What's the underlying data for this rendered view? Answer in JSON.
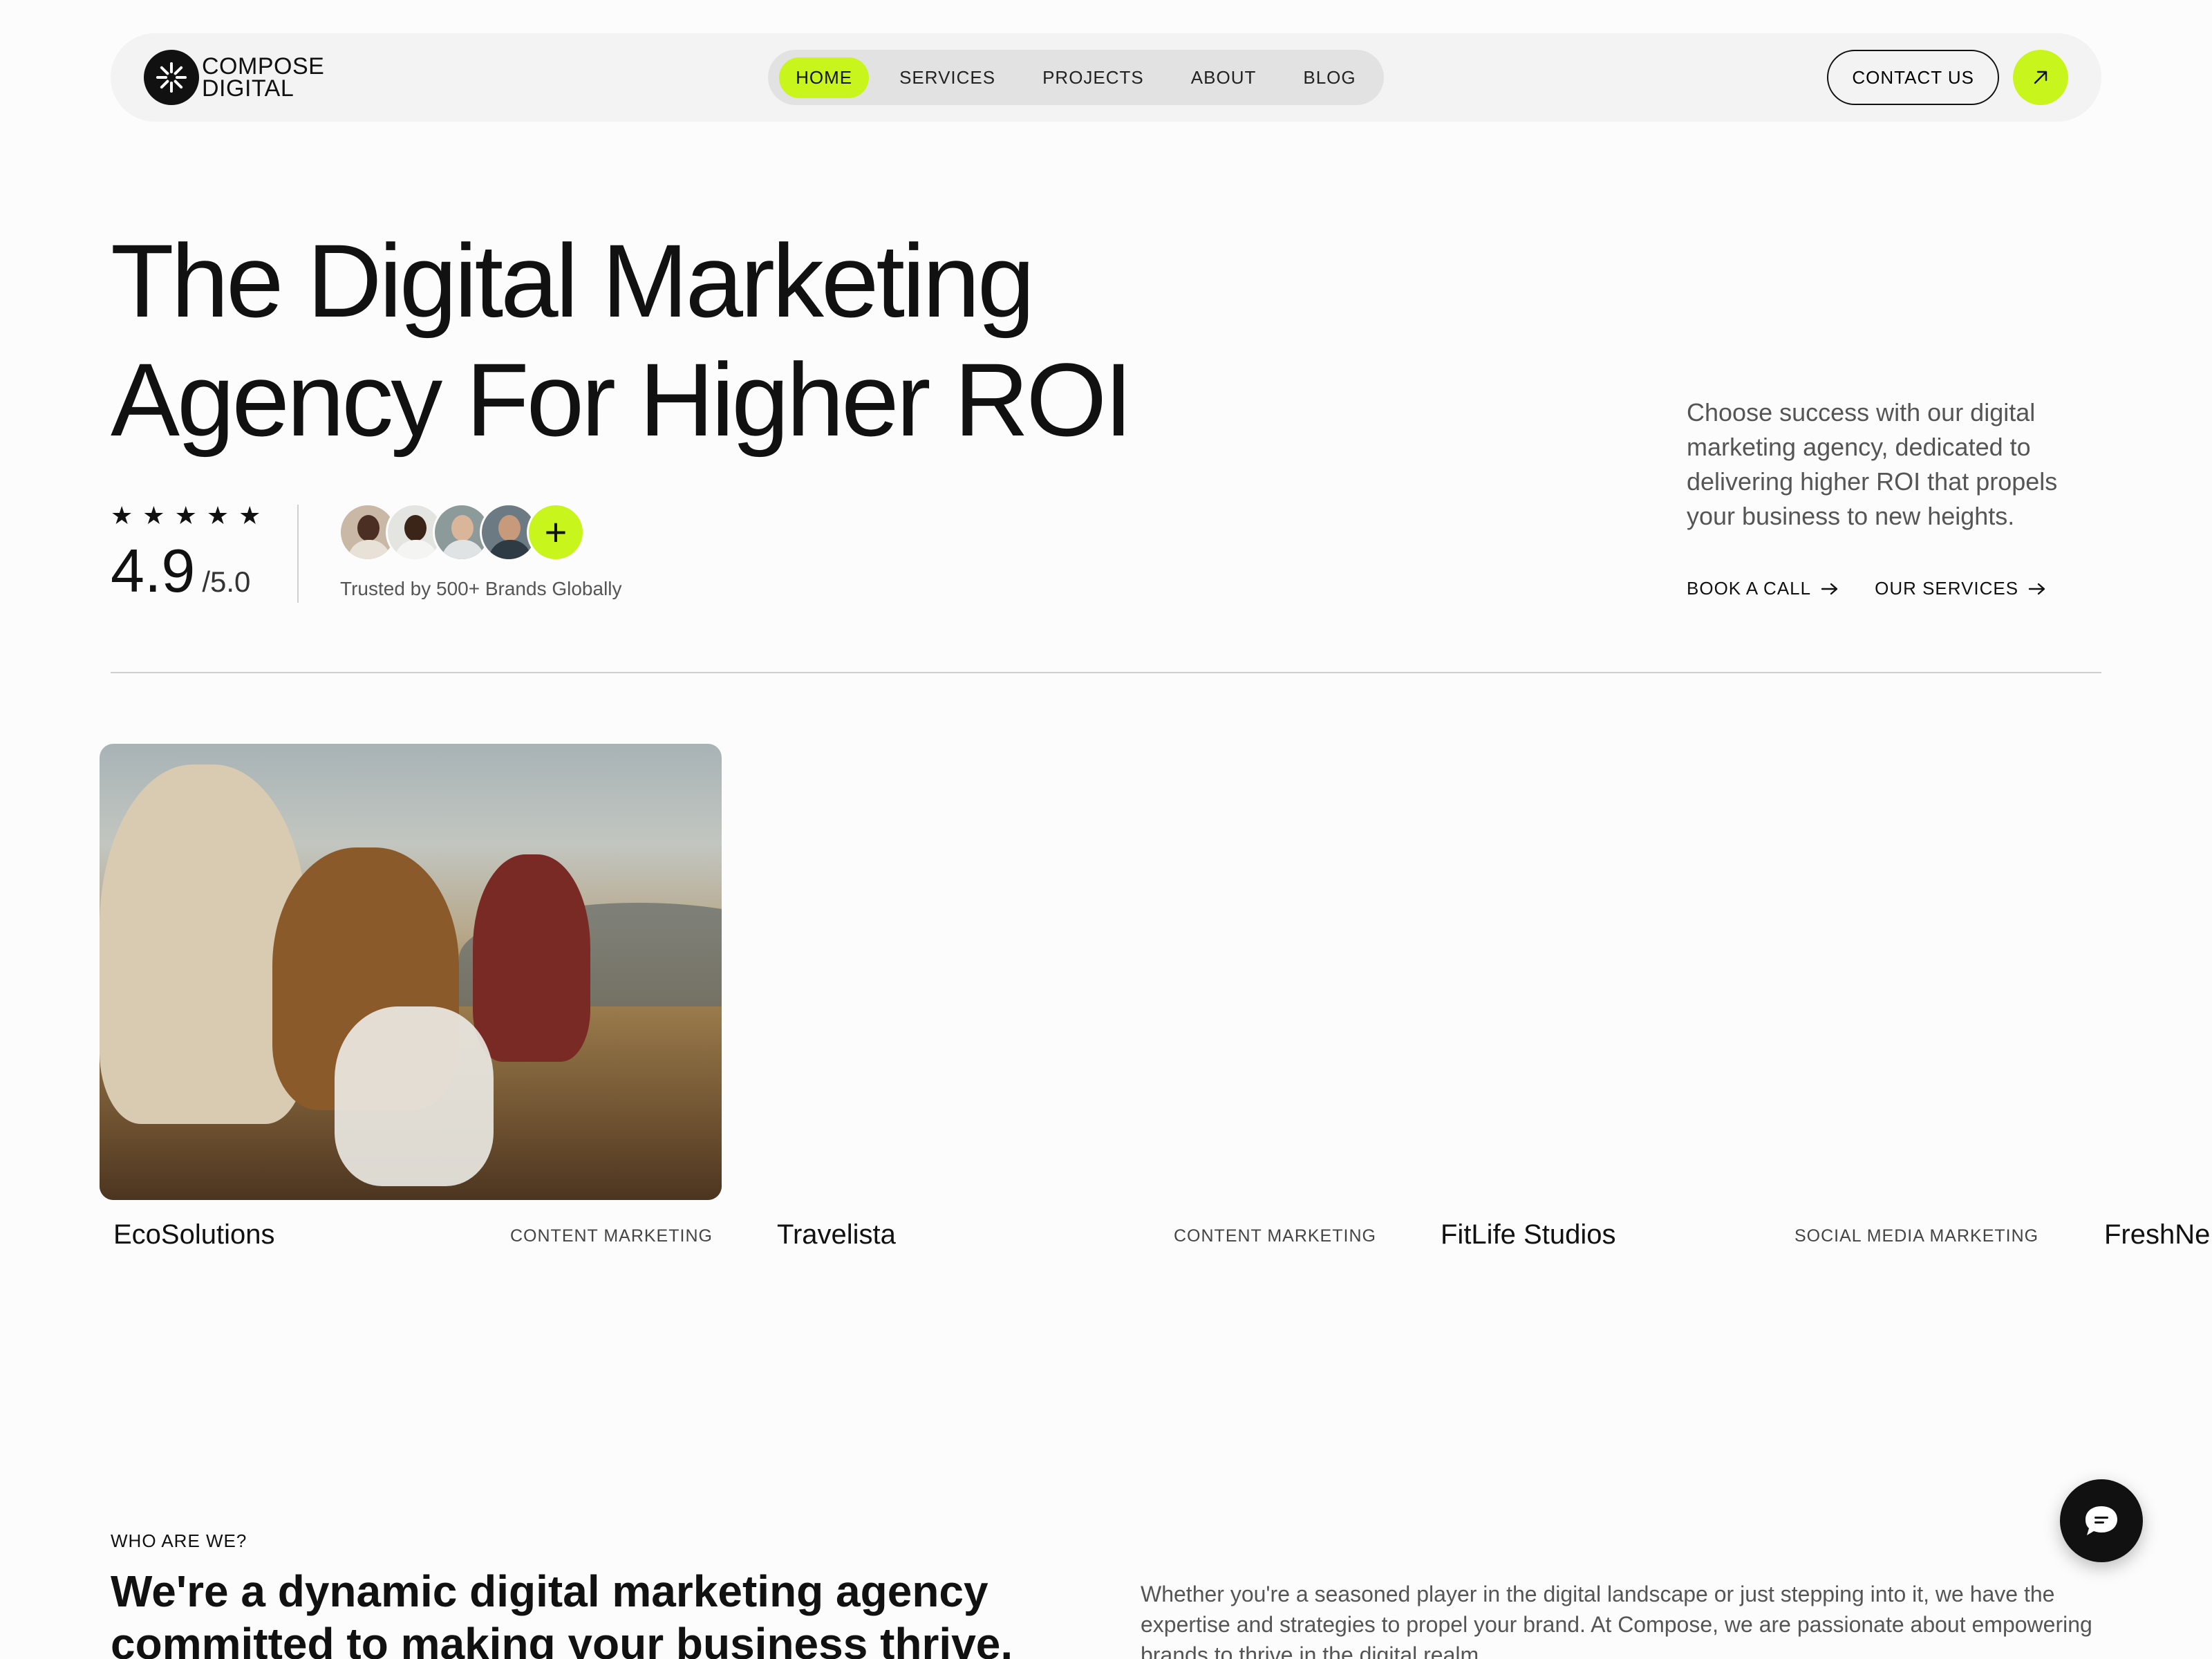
{
  "brand": {
    "line1": "COMPOSE",
    "line2": "DIGITAL",
    "logo_icon": "sunburst-icon",
    "accent_color": "#c8f51b"
  },
  "nav": {
    "items": [
      {
        "label": "HOME",
        "active": true
      },
      {
        "label": "SERVICES",
        "active": false
      },
      {
        "label": "PROJECTS",
        "active": false
      },
      {
        "label": "ABOUT",
        "active": false
      },
      {
        "label": "BLOG",
        "active": false
      }
    ],
    "contact_label": "CONTACT US",
    "arrow_icon": "arrow-up-right-icon"
  },
  "hero": {
    "title_line1": "The Digital Marketing",
    "title_line2": "Agency For Higher ROI",
    "rating": {
      "stars": 5,
      "score": "4.9",
      "out_of": "/5.0"
    },
    "avatars_count": 4,
    "plus_icon": "plus-icon",
    "trusted_text": "Trusted by 500+ Brands Globally",
    "description": "Choose success with our digital marketing agency, dedicated to delivering higher ROI that propels your business to new heights.",
    "links": [
      {
        "label": "BOOK A CALL",
        "icon": "arrow-right-icon"
      },
      {
        "label": "OUR SERVICES",
        "icon": "arrow-right-icon"
      }
    ]
  },
  "projects": [
    {
      "name": "EcoSolutions",
      "tag": "CONTENT MARKETING"
    },
    {
      "name": "Travelista",
      "tag": "CONTENT MARKETING"
    },
    {
      "name": "FitLife Studios",
      "tag": "SOCIAL MEDIA MARKETING"
    },
    {
      "name": "FreshNe",
      "tag": ""
    }
  ],
  "about": {
    "eyebrow": "WHO ARE WE?",
    "heading_line1": "We're a dynamic digital marketing agency",
    "heading_line2": "committed to making your business thrive.",
    "body": "Whether you're a seasoned player in the digital landscape or just stepping into it, we have the expertise and strategies to propel your brand. At Compose, we are passionate about empowering brands to thrive in the digital realm."
  },
  "chat": {
    "icon": "chat-bubble-icon"
  }
}
